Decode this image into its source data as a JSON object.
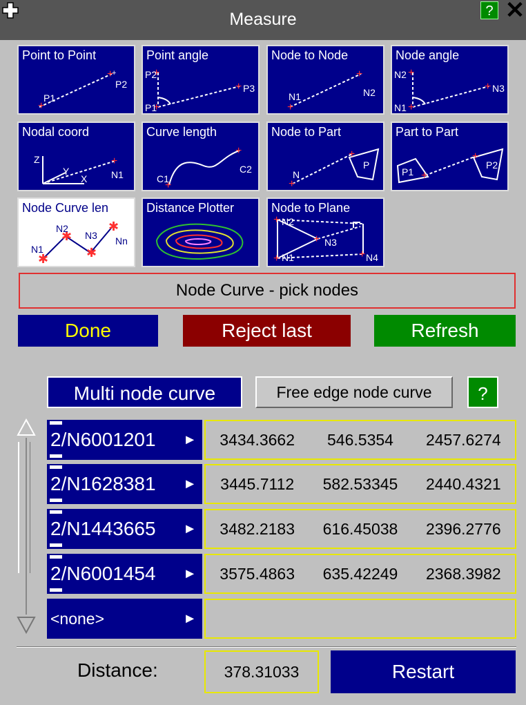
{
  "window": {
    "title": "Measure",
    "help": "?",
    "close": "✕"
  },
  "tiles": [
    {
      "label": "Point to Point",
      "p1": "P1",
      "p2": "P2"
    },
    {
      "label": "Point angle",
      "p1": "P2",
      "p2": "P1",
      "p3": "P3"
    },
    {
      "label": "Node to Node",
      "p1": "N1",
      "p2": "N2"
    },
    {
      "label": "Node angle",
      "p1": "N2",
      "p2": "N1",
      "p3": "N3"
    },
    {
      "label": "Nodal coord",
      "p1": "Z",
      "p2": "Y",
      "p3": "X",
      "p4": "N1"
    },
    {
      "label": "Curve length",
      "p1": "C1",
      "p2": "C2"
    },
    {
      "label": "Node to Part",
      "p1": "N",
      "p2": "P"
    },
    {
      "label": "Part to Part",
      "p1": "P1",
      "p2": "P2"
    },
    {
      "label": "Node Curve len",
      "p1": "N1",
      "p2": "N2",
      "p3": "N3",
      "p4": "Nn"
    },
    {
      "label": "Distance Plotter"
    },
    {
      "label": "Node to Plane",
      "p1": "N2",
      "p2": "N1",
      "p3": "N3",
      "p4": "N4"
    }
  ],
  "status": "Node Curve - pick nodes",
  "buttons": {
    "done": "Done",
    "reject": "Reject last",
    "refresh": "Refresh",
    "multi": "Multi node curve",
    "free": "Free edge node curve",
    "help": "?",
    "restart": "Restart"
  },
  "nodes": [
    {
      "id": "2/N6001201",
      "x": "3434.3662",
      "y": "546.5354",
      "z": "2457.6274"
    },
    {
      "id": "2/N1628381",
      "x": "3445.7112",
      "y": "582.53345",
      "z": "2440.4321"
    },
    {
      "id": "2/N1443665",
      "x": "3482.2183",
      "y": "616.45038",
      "z": "2396.2776"
    },
    {
      "id": "2/N6001454",
      "x": "3575.4863",
      "y": "635.42249",
      "z": "2368.3982"
    },
    {
      "id": "<none>",
      "x": "",
      "y": "",
      "z": ""
    }
  ],
  "distance": {
    "label": "Distance:",
    "value": "378.31033"
  },
  "colors": {
    "accent": "#00008b",
    "reject": "#8b0000",
    "ok": "#008a00",
    "highlight": "#ffff00"
  }
}
